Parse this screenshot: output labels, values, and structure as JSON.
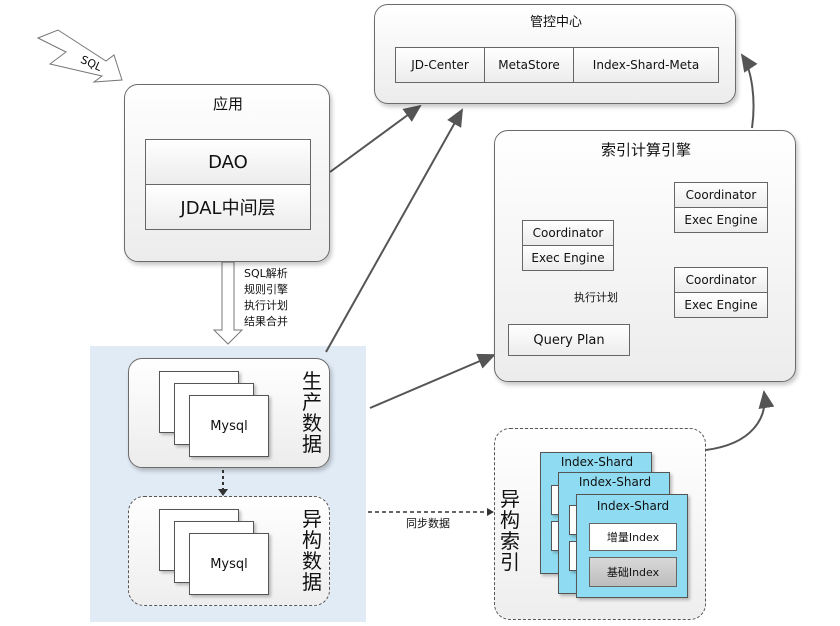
{
  "sql_tag": "SQL",
  "control_center": {
    "title": "管控中心",
    "cells": [
      "JD-Center",
      "MetaStore",
      "Index-Shard-Meta"
    ]
  },
  "app": {
    "title": "应用",
    "dao": "DAO",
    "jdal": "JDAL中间层"
  },
  "steps": [
    "SQL解析",
    "规则引擎",
    "执行计划",
    "结果合并"
  ],
  "engine": {
    "title": "索引计算引擎",
    "coord": "Coordinator",
    "exec": "Exec Engine",
    "plan_label": "执行计划",
    "query_plan": "Query Plan"
  },
  "prod": {
    "db": "Mysql",
    "label": [
      "生",
      "产",
      "数",
      "据"
    ]
  },
  "hetero": {
    "db": "Mysql",
    "label": [
      "异",
      "构",
      "数",
      "据"
    ]
  },
  "sync_label": "同步数据",
  "index": {
    "label": [
      "异",
      "构",
      "索",
      "引"
    ],
    "shard_title": "Index-Shard",
    "incr": "增量Index",
    "base": "基础Index"
  }
}
